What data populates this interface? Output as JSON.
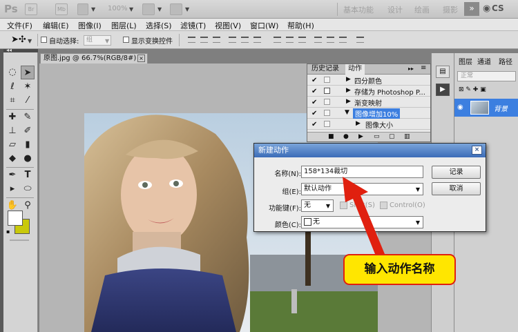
{
  "appbar": {
    "logo": "Ps",
    "zoom": "100%",
    "workspaces": [
      "基本功能",
      "设计",
      "绘画",
      "摄影"
    ],
    "more": "»",
    "cs_live": "CS"
  },
  "menubar": [
    "文件(F)",
    "编辑(E)",
    "图像(I)",
    "图层(L)",
    "选择(S)",
    "滤镜(T)",
    "视图(V)",
    "窗口(W)",
    "帮助(H)"
  ],
  "options": {
    "auto_select_label": "自动选择:",
    "group_placeholder": "组",
    "show_transform_label": "显示变换控件"
  },
  "document": {
    "tab_label": "原图.jpg @ 66.7%(RGB/8#)",
    "close": "×"
  },
  "colors": {
    "foreground": "#ffffff",
    "background": "#c9c90a",
    "accent": "#3c7fe0",
    "callout_fill": "#ffe600",
    "callout_border": "#e0200f"
  },
  "actions_panel": {
    "tabs": [
      "历史记录",
      "动作"
    ],
    "menu_icon": "▸▸",
    "rows": [
      {
        "label": "四分颜色",
        "checked": "✔",
        "indent": 1
      },
      {
        "label": "存储为 Photoshop P...",
        "checked": "✔",
        "indent": 1
      },
      {
        "label": "渐变映射",
        "checked": "✔",
        "indent": 1
      },
      {
        "label": "图像增加10%",
        "checked": "✔",
        "indent": 0,
        "highlighted": true
      },
      {
        "label": "图像大小",
        "checked": "✔",
        "indent": 2
      }
    ]
  },
  "layers_panel": {
    "tabs": [
      "图层",
      "通道",
      "路径"
    ],
    "blend_mode": "正常",
    "layer_name": "背景"
  },
  "dialog": {
    "title": "新建动作",
    "close": "×",
    "name_label": "名称(N):",
    "name_value": "158*134裁切",
    "group_label": "组(E):",
    "group_value": "默认动作",
    "fkey_label": "功能键(F):",
    "fkey_value": "无",
    "shift_label": "Shift(S)",
    "control_label": "Control(O)",
    "color_label": "颜色(C):",
    "color_value": "无",
    "record_button": "记录",
    "cancel_button": "取消"
  },
  "callout": {
    "text": "输入动作名称"
  }
}
